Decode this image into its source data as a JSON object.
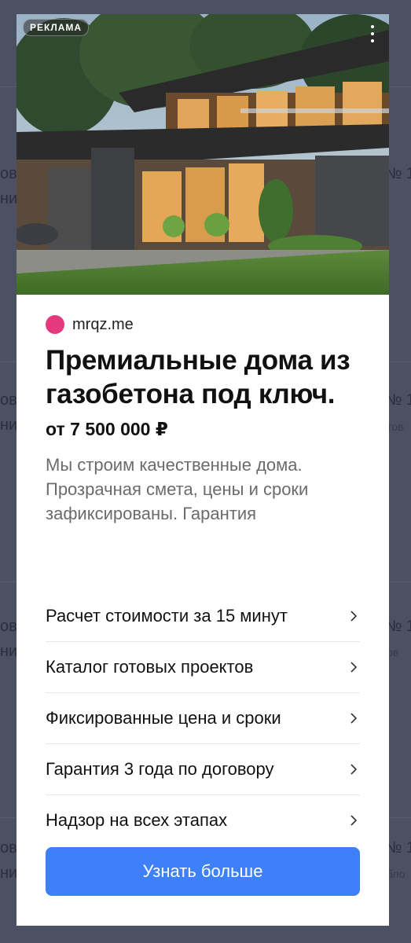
{
  "ad": {
    "badge": "РЕКЛАМА",
    "source": "mrqz.me",
    "title": "Премиальные дома из газобетона под ключ.",
    "price": "от 7 500 000 ₽",
    "description": "Мы строим качественные дома. Прозрачная смета, цены и сроки зафиксированы. Гарантия",
    "links": [
      {
        "label": "Расчет стоимости за 15 минут",
        "icon": "chevron-right-icon"
      },
      {
        "label": "Каталог готовых проектов",
        "icon": "chevron-right-icon"
      },
      {
        "label": "Фиксированные цена и сроки",
        "icon": "chevron-right-icon"
      },
      {
        "label": "Гарантия 3 года по договору",
        "icon": "chevron-right-icon"
      },
      {
        "label": "Надзор на всех этапах",
        "icon": "chevron-right-icon"
      }
    ],
    "cta_label": "Узнать больше",
    "colors": {
      "accent": "#3d80f8",
      "source_dot": "#e5397d",
      "overlay": "#4b5163"
    }
  },
  "background": {
    "left_fragments": [
      "ов",
      "ни",
      "ов",
      "ни",
      "ов",
      "ни",
      "ов",
      "ни"
    ],
    "right_fragments": [
      "№ 1",
      "№ 1",
      "тов",
      "№ 1",
      "ов",
      "№ 1",
      "бло"
    ]
  }
}
